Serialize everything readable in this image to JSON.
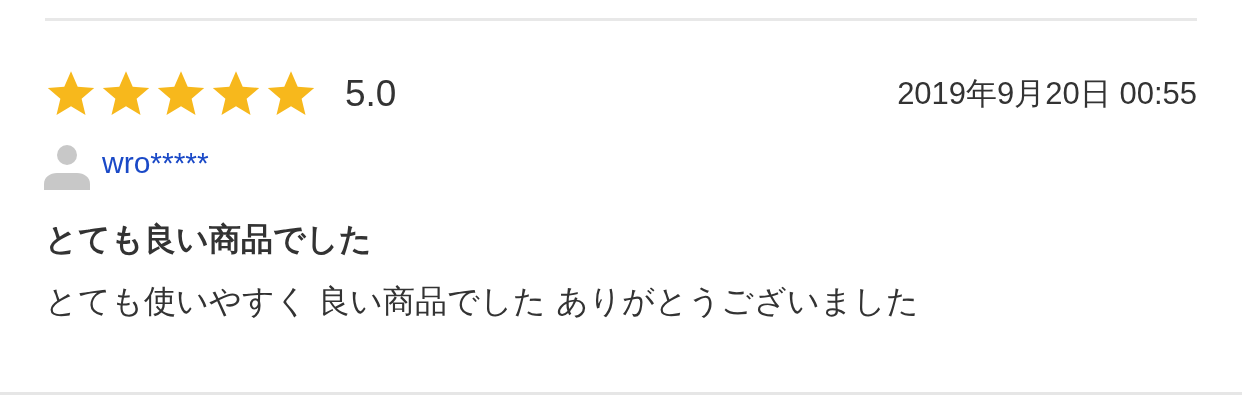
{
  "review": {
    "stars": 5,
    "rating": "5.0",
    "date": "2019年9月20日 00:55",
    "user": "wro*****",
    "title": "とても良い商品でした",
    "body": "とても使いやすく 良い商品でした ありがとうございました"
  }
}
